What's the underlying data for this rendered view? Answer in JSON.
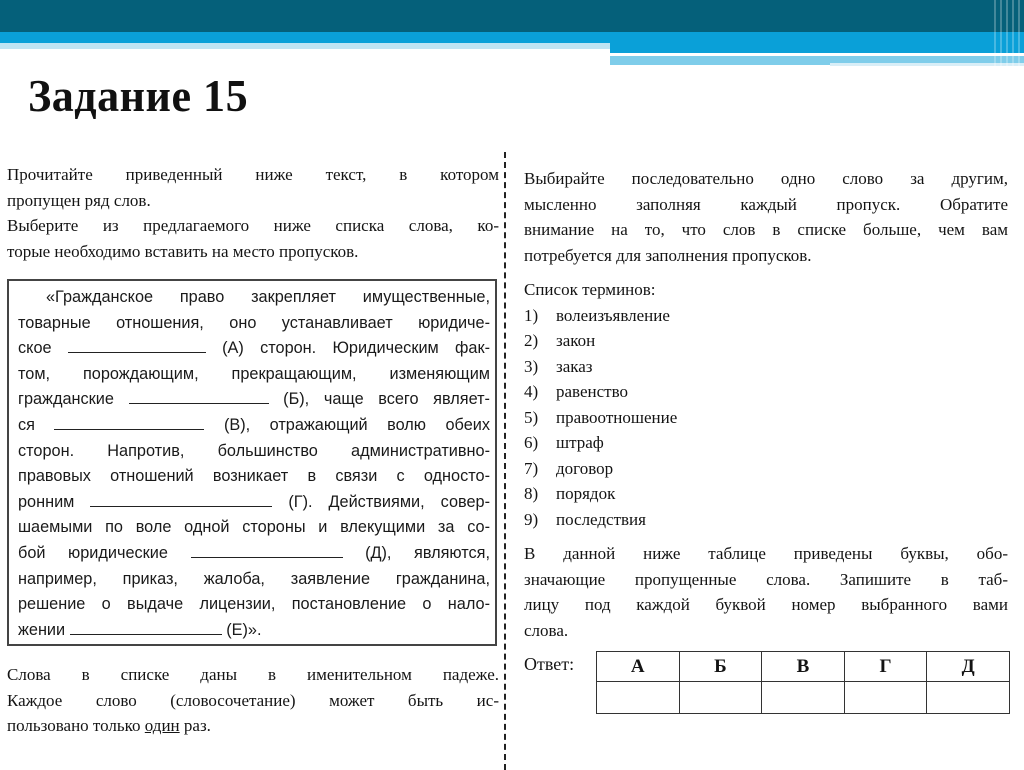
{
  "slide": {
    "title": "Задание 15",
    "colors": {
      "header_dark": "#05607a",
      "header_blue": "#0aa0d8",
      "header_light": "#7fcdea"
    }
  },
  "instructions_left": {
    "p1_lines": [
      "Прочитайте приведенный ниже текст, в котором",
      "пропущен ряд слов."
    ],
    "p2_lines": [
      "Выберите из предлагаемого ниже списка слова, ко-",
      "торые необходимо вставить на место пропусков."
    ]
  },
  "passage": {
    "lines": [
      "«Гражданское право закрепляет имущественные,",
      "товарные отношения, оно устанавливает юридиче-",
      {
        "before": "ское",
        "blank": "A",
        "after": "(А) сторон. Юридическим фак-"
      },
      "том, порождающим, прекращающим, изменяющим",
      {
        "before": "гражданские",
        "blank": "Б",
        "after": "(Б), чаще всего являет-"
      },
      {
        "before": "ся",
        "blank": "В",
        "after": "(В), отражающий волю обеих"
      },
      "сторон. Напротив, большинство административно-",
      "правовых отношений возникает в связи с односто-",
      {
        "before": "ронним",
        "blank": "Г",
        "after": "(Г). Действиями, совер-"
      },
      "шаемыми по воле одной стороны и влекущими за со-",
      {
        "before": "бой юридические",
        "blank": "Д",
        "after": "(Д), являются,"
      },
      "например, приказ, жалоба, заявление гражданина,",
      "решение о выдаче лицензии, постановление о нало-",
      {
        "before": "жении",
        "blank": "Е",
        "after": "(Е)»."
      }
    ],
    "l0": "«Гражданское право закрепляет имущественные,",
    "l1": "товарные отношения, оно устанавливает юридиче-",
    "l2a": "ское",
    "l2b": "(А) сторон. Юридическим фак-",
    "l3": "том, порождающим, прекращающим, изменяющим",
    "l4a": "гражданские",
    "l4b": "(Б), чаще всего являет-",
    "l5a": "ся",
    "l5b": "(В), отражающий волю обеих",
    "l6": "сторон. Напротив, большинство административно-",
    "l7": "правовых отношений возникает в связи с односто-",
    "l8a": "ронним",
    "l8b": "(Г). Действиями, совер-",
    "l9": "шаемыми по воле одной стороны и влекущими за со-",
    "l10a": "бой юридические",
    "l10b": "(Д), являются,",
    "l11": "например, приказ, жалоба, заявление гражданина,",
    "l12": "решение о выдаче лицензии, постановление о нало-",
    "l13a": "жении",
    "l13b": "(Е)»."
  },
  "note_left": {
    "line1": "Слова в списке даны в именительном падеже.",
    "line2": "Каждое слово (словосочетание) может быть ис-",
    "line3_before": "пользовано только",
    "line3_underlined": "один",
    "line3_after": "раз."
  },
  "instructions_right": {
    "lines": [
      "Выбирайте последовательно одно слово за другим,",
      "мысленно заполняя каждый пропуск. Обратите",
      "внимание на то, что слов в списке больше, чем вам",
      "потребуется для заполнения пропусков."
    ]
  },
  "terms": {
    "title": "Список терминов:",
    "items": [
      {
        "num": "1)",
        "term": "волеизъявление"
      },
      {
        "num": "2)",
        "term": "закон"
      },
      {
        "num": "3)",
        "term": "заказ"
      },
      {
        "num": "4)",
        "term": "равенство"
      },
      {
        "num": "5)",
        "term": "правоотношение"
      },
      {
        "num": "6)",
        "term": "штраф"
      },
      {
        "num": "7)",
        "term": "договор"
      },
      {
        "num": "8)",
        "term": "порядок"
      },
      {
        "num": "9)",
        "term": "последствия"
      }
    ]
  },
  "table_instructions": {
    "lines": [
      "В данной ниже таблице приведены буквы, обо-",
      "значающие пропущенные слова. Запишите в таб-",
      "лицу под каждой буквой номер выбранного вами",
      "слова."
    ]
  },
  "answer": {
    "label": "Ответ:",
    "headers": [
      "А",
      "Б",
      "В",
      "Г",
      "Д"
    ],
    "values": [
      "",
      "",
      "",
      "",
      ""
    ]
  }
}
